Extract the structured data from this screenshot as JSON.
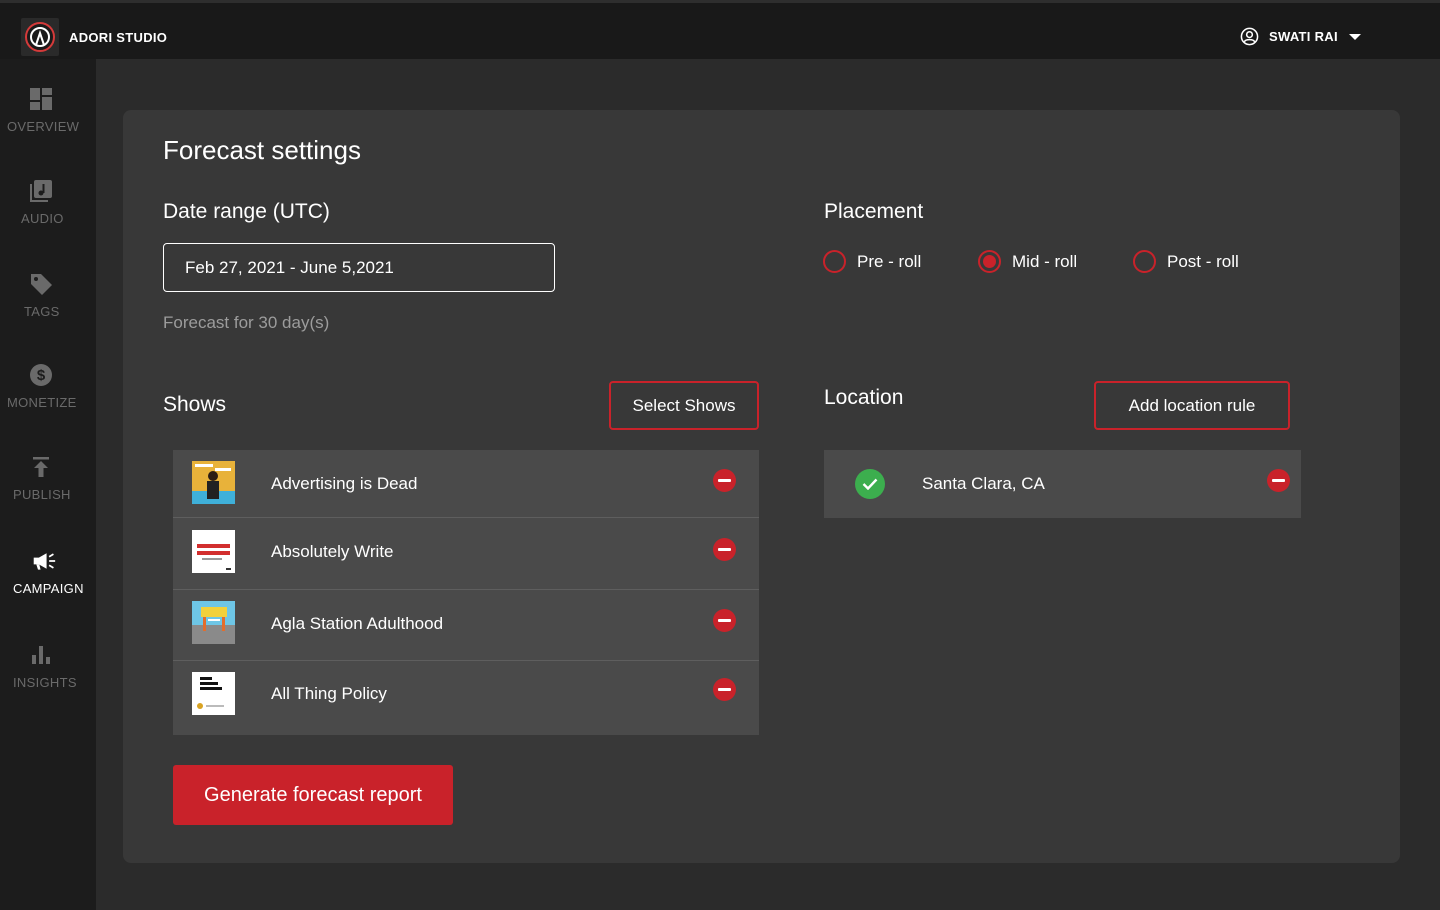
{
  "app": {
    "title": "ADORI STUDIO",
    "user": "SWATI RAI"
  },
  "sidebar": {
    "items": [
      {
        "label": "OVERVIEW",
        "icon": "dashboard-icon"
      },
      {
        "label": "AUDIO",
        "icon": "audio-library-icon"
      },
      {
        "label": "TAGS",
        "icon": "tag-icon"
      },
      {
        "label": "MONETIZE",
        "icon": "dollar-icon"
      },
      {
        "label": "PUBLISH",
        "icon": "publish-icon"
      },
      {
        "label": "CAMPAIGN",
        "icon": "megaphone-icon",
        "active": true
      },
      {
        "label": "INSIGHTS",
        "icon": "bar-chart-icon"
      }
    ]
  },
  "forecast": {
    "title": "Forecast settings",
    "date_range_label": "Date range (UTC)",
    "date_range_value": "Feb 27, 2021 - June 5,2021",
    "forecast_days": "Forecast for 30 day(s)",
    "placement_label": "Placement",
    "placement_options": [
      {
        "label": "Pre - roll",
        "selected": false
      },
      {
        "label": "Mid - roll",
        "selected": true
      },
      {
        "label": "Post - roll",
        "selected": false
      }
    ],
    "shows_label": "Shows",
    "select_shows_button": "Select Shows",
    "shows": [
      {
        "name": "Advertising is Dead"
      },
      {
        "name": "Absolutely Write"
      },
      {
        "name": "Agla Station Adulthood"
      },
      {
        "name": "All Thing Policy"
      }
    ],
    "location_label": "Location",
    "add_location_button": "Add location rule",
    "locations": [
      {
        "name": "Santa Clara, CA"
      }
    ],
    "generate_button": "Generate forecast report"
  },
  "colors": {
    "accent": "#c9222a",
    "success": "#3cae4e",
    "card": "#383838",
    "list": "#4a4a4a"
  }
}
